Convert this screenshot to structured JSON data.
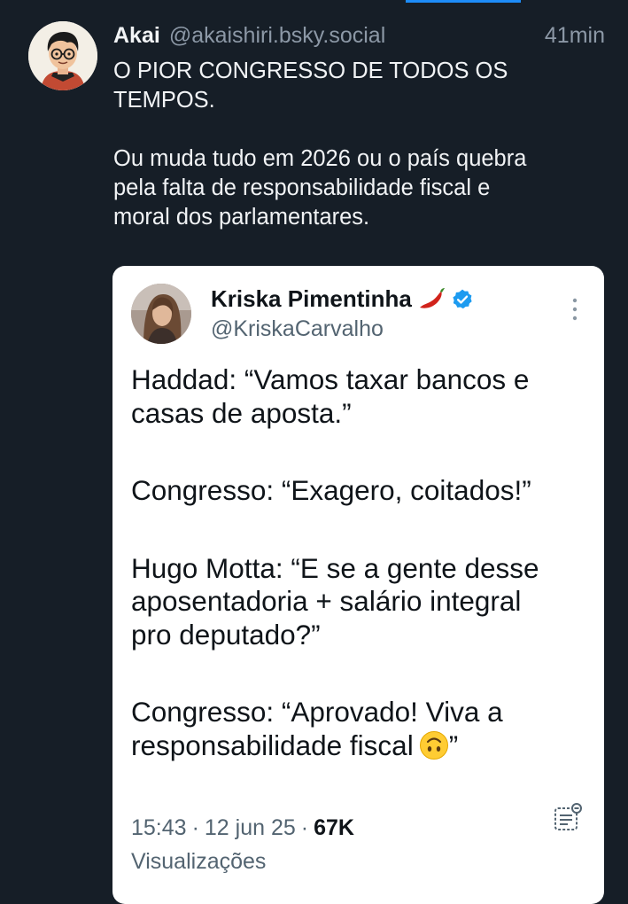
{
  "post": {
    "author_name": "Akai",
    "author_handle": "@akaishiri.bsky.social",
    "time": "41min",
    "text_line1": "O PIOR CONGRESSO DE TODOS OS",
    "text_line2": "TEMPOS.",
    "text_line3": "Ou muda tudo em 2026 ou o país quebra",
    "text_line4": "pela falta de responsabilidade fiscal e",
    "text_line5": "moral dos parlamentares."
  },
  "embed": {
    "name": "Kriska Pimentinha",
    "handle": "@KriskaCarvalho",
    "body": {
      "line1": "Haddad: “Vamos taxar bancos e",
      "line2": "casas de aposta.”",
      "line3": "Congresso: “Exagero, coitados!”",
      "line4": "Hugo Motta: “E se a gente desse",
      "line5": "aposentadoria + salário integral",
      "line6": "pro deputado?”",
      "line7": "Congresso: “Aprovado! Viva a",
      "line8": "responsabilidade fiscal",
      "line8_end": "”"
    },
    "time": "15:43",
    "date": "12 jun 25",
    "views_count": "67K",
    "views_label": "Visualizações",
    "icons": {
      "emoji": "upside-down-face",
      "name_emoji": "chili-pepper",
      "verified": "verified-badge",
      "more": "vertical-ellipsis",
      "notes": "notes"
    }
  },
  "colors": {
    "background": "#161e27",
    "text_primary": "#f1f3f5",
    "text_secondary": "#8c98a6",
    "accent_blue": "#1d8cf8"
  }
}
